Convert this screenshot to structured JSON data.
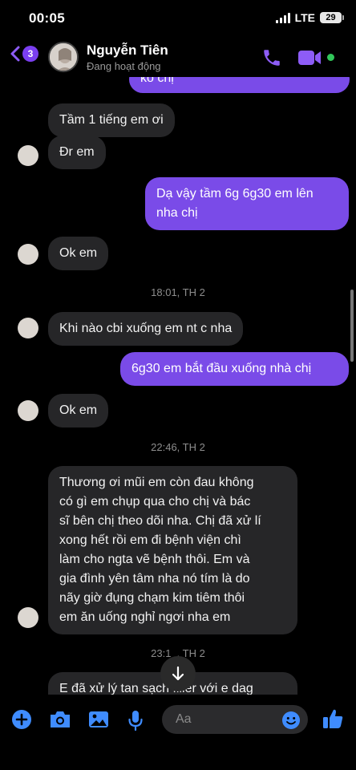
{
  "status_bar": {
    "time": "00:05",
    "network": "LTE",
    "battery": "29"
  },
  "header": {
    "back_badge": "3",
    "contact_name": "Nguyễn Tiên",
    "contact_status": "Đang hoạt động"
  },
  "conversation": {
    "messages": [
      {
        "direction": "out",
        "text": "ko chị"
      },
      {
        "direction": "in",
        "text": "Tầm 1 tiếng em ơi"
      },
      {
        "direction": "in",
        "text": "Đr em"
      },
      {
        "direction": "out",
        "lines": [
          "Dạ vậy tầm 6g 6g30 em lên",
          "nha chị"
        ]
      },
      {
        "direction": "in",
        "text": "Ok em"
      },
      {
        "type": "timestamp",
        "text": "18:01, TH 2"
      },
      {
        "direction": "in",
        "text": "Khi nào cbi xuống em nt c nha"
      },
      {
        "direction": "out",
        "text": "6g30 em bắt đầu xuống nhà chị"
      },
      {
        "direction": "in",
        "text": "Ok em"
      },
      {
        "type": "timestamp",
        "text": "22:46, TH 2"
      },
      {
        "direction": "in",
        "lines": [
          "Thương ơi mũi em còn đau không",
          "có gì em chụp qua cho chị và bác",
          "sĩ bên chị theo dõi nha. Chị đã xử lí",
          "xong hết rồi em đi bệnh viện chì",
          "làm cho ngta vẽ bệnh thôi. Em và",
          "gia đình yên tâm nha nó tím là do",
          "nãy giờ đụng chạm kim tiêm thôi",
          "em ăn uống nghỉ ngơi nha em"
        ]
      },
      {
        "type": "timestamp",
        "text": "23:1_, TH 2"
      },
      {
        "direction": "in",
        "text": "E đã xử lý tan sạch filler với e dag"
      }
    ]
  },
  "composer": {
    "placeholder": "Aa"
  },
  "colors": {
    "outgoing": "#7a4be8",
    "incoming": "#262628",
    "accent": "#7b3ff0",
    "online": "#31c75a",
    "composer_icons": "#3f8cff"
  },
  "icons": [
    "back-chevron-icon",
    "phone-icon",
    "video-camera-icon",
    "plus-icon",
    "camera-icon",
    "gallery-icon",
    "microphone-icon",
    "emoji-icon",
    "thumbs-up-icon",
    "arrow-down-icon"
  ]
}
